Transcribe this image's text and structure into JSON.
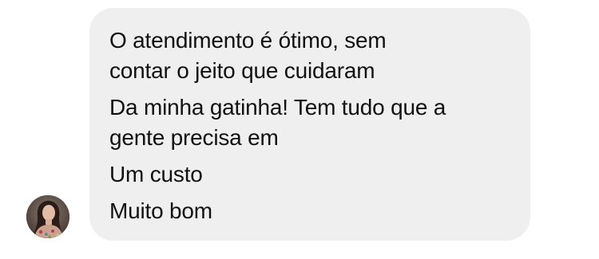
{
  "conversation": {
    "message": {
      "lines": [
        "O atendimento é ótimo, sem",
        "contar o jeito que cuidaram",
        "Da minha gatinha! Tem tudo que a",
        "gente precisa em",
        "Um custo",
        "Muito bom"
      ]
    },
    "sender": {
      "avatar_icon": "profile-photo"
    }
  },
  "colors": {
    "bubble_background": "#efefef",
    "text": "#111111",
    "page_background": "#ffffff"
  }
}
